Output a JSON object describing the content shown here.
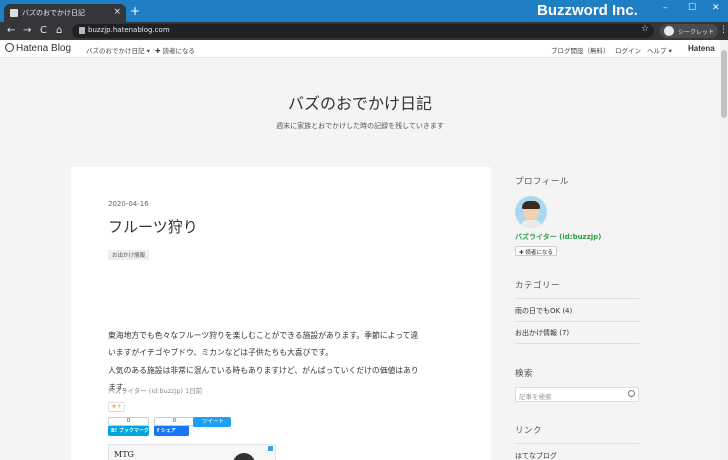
{
  "browser": {
    "tab_title": "バズのおでかけ日記",
    "tab_close": "×",
    "new_tab": "+",
    "brand": "Buzzword Inc.",
    "url": "buzzjp.hatenablog.com",
    "incognito_label": "シークレット",
    "window_controls": [
      "–",
      "☐",
      "✕"
    ],
    "nav": {
      "back": "←",
      "forward": "→",
      "reload": "C",
      "home": "⌂"
    },
    "bookmark_star": "☆",
    "menu": "⋮"
  },
  "hatena_bar": {
    "logo": "Hatena Blog",
    "blog_menu": "バズのおでかけ日記 ▾",
    "reader_button": "✚ 読者になる",
    "links": [
      "ブログ開設（無料）",
      "ログイン",
      "ヘルプ ▾"
    ],
    "right_logo": "Hatena"
  },
  "header": {
    "title": "バズのおでかけ日記",
    "description": "週末に家族とおでかけした時の記録を残していきます"
  },
  "article": {
    "date": "2020-04-16",
    "title": "フルーツ狩り",
    "category": "お出かけ情報",
    "paragraphs": [
      "東海地方でも色々なフルーツ狩りを楽しむことができる施設があります。季節によって違",
      "いますがイチゴやブドウ、ミカンなどは子供たちも大喜びです。",
      "人気のある施設は非常に混んでいる時もありますけど、がんばっていくだけの価値はあり",
      "ます。"
    ],
    "author_line": "バズライター (id:buzzjp) 1日前",
    "star": "★+",
    "hatebu_count": "0",
    "hatebu_label": "B! ブックマーク",
    "fb_count": "0",
    "fb_label": "f シェア",
    "tweet_label": "ツイート",
    "ad_text": "MTG"
  },
  "sidebar": {
    "profile_heading": "プロフィール",
    "profile_name": "バズライター (id:buzzjp)",
    "reader_button": "✚ 読者になる",
    "category_heading": "カテゴリー",
    "categories": [
      "雨の日でもOK (4)",
      "お出かけ情報 (7)"
    ],
    "search_heading": "検索",
    "search_placeholder": "記事を検索",
    "link_heading": "リンク",
    "links": [
      "はてなブログ"
    ]
  },
  "colors": {
    "titlebar": "#1f7fc4",
    "profile_name": "#2b9f45",
    "hatebu": "#00a4de",
    "facebook": "#1877f2",
    "twitter": "#1da1f2"
  }
}
